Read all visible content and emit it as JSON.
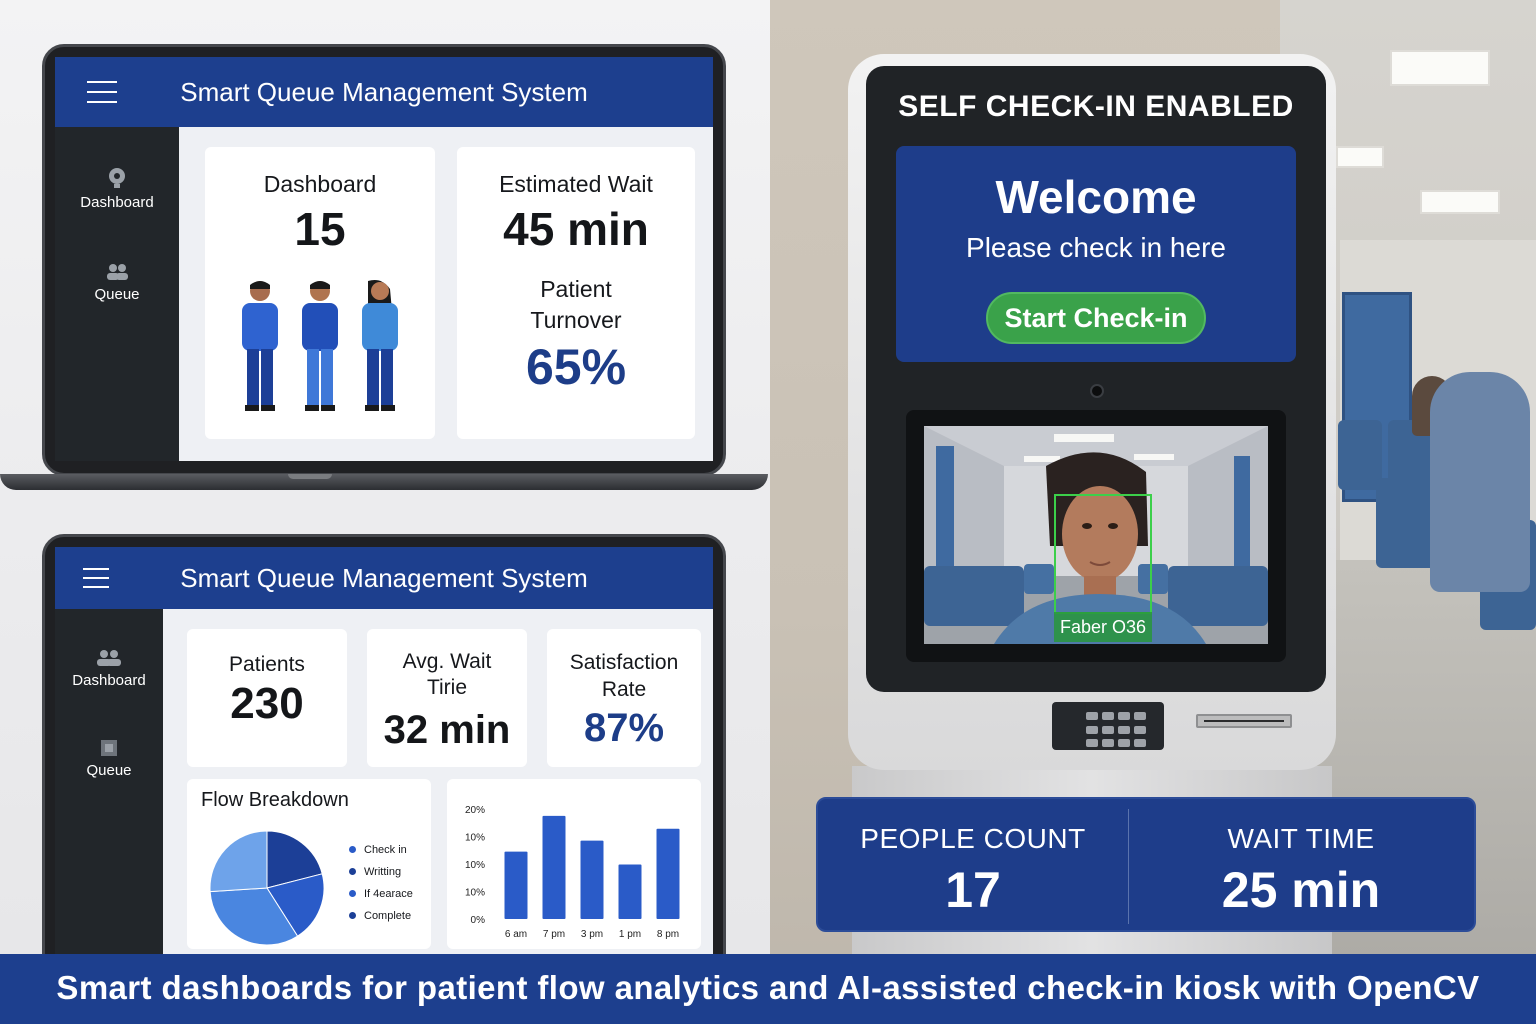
{
  "top_dashboard": {
    "title": "Smart Queue Management System",
    "sidebar": [
      {
        "label": "Dashboard",
        "icon": "camera-icon"
      },
      {
        "label": "Queue",
        "icon": "people-icon"
      }
    ],
    "cards": {
      "dashboard_label": "Dashboard",
      "dashboard_value": "15",
      "wait_label": "Estimated Wait",
      "wait_value": "45 min",
      "turnover_label": "Patient Turnover",
      "turnover_value": "65%"
    }
  },
  "bottom_dashboard": {
    "title": "Smart Queue Management System",
    "sidebar": [
      {
        "label": "Dashboard",
        "icon": "people-icon"
      },
      {
        "label": "Queue",
        "icon": "box-icon"
      }
    ],
    "kpis": [
      {
        "label": "Patients",
        "value": "230"
      },
      {
        "label": "Avg. Wait Tirie",
        "value": "32 min"
      },
      {
        "label": "Satisfaction Rate",
        "value": "87%"
      }
    ],
    "flow_title": "Flow Breakdown",
    "legend": [
      "Check in",
      "Writting",
      "If 4earace",
      "Complete"
    ]
  },
  "kiosk": {
    "title": "SELF CHECK-IN ENABLED",
    "welcome": "Welcome",
    "subtitle": "Please check in here",
    "button": "Start Check-in",
    "face_label": "Faber O36"
  },
  "stats": {
    "people_label": "PEOPLE COUNT",
    "people_value": "17",
    "wait_label": "WAIT TIME",
    "wait_value": "25 min"
  },
  "caption": "Smart dashboards for patient flow analytics and AI-assisted check-in kiosk with OpenCV",
  "colors": {
    "navy": "#1d3f8e",
    "kpi_blue": "#1d3d88",
    "green": "#3aa24a",
    "pie_shades": [
      "#1c3f97",
      "#2a5bc8",
      "#4a86e0",
      "#6ea3ea"
    ]
  },
  "chart_data": [
    {
      "type": "pie",
      "title": "Flow Breakdown",
      "categories": [
        "Check in",
        "Writting",
        "If 4earace",
        "Complete"
      ],
      "values": [
        21,
        20,
        33,
        26
      ]
    },
    {
      "type": "bar",
      "title": "",
      "categories": [
        "6 am",
        "7 pm",
        "3 pm",
        "1 pm",
        "8 pm"
      ],
      "values": [
        68,
        104,
        79,
        55,
        91
      ],
      "y_tick_labels": [
        "20%",
        "10%",
        "10%",
        "10%",
        "0%"
      ],
      "ylim": [
        0,
        115
      ],
      "bar_color": "#2a5bc8",
      "grid": false
    }
  ]
}
